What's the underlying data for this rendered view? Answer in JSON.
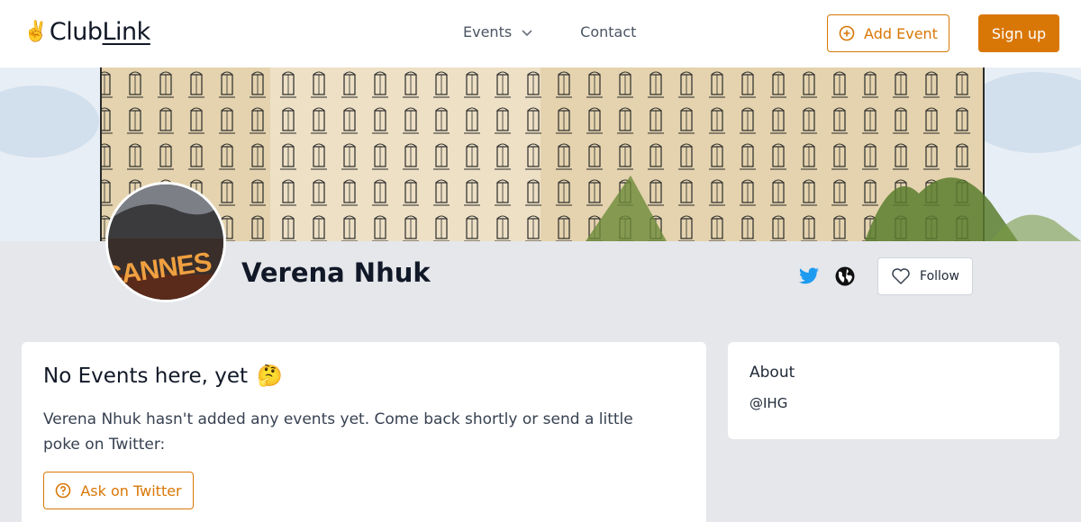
{
  "header": {
    "logo_icon": "victory-hand-emoji",
    "logo_prefix": "Club",
    "logo_suffix": "Link",
    "nav_events": "Events",
    "nav_contact": "Contact",
    "add_event_label": "Add Event",
    "signup_label": "Sign up"
  },
  "profile": {
    "name": "Verena Nhuk",
    "avatar_text": "CANNES",
    "follow_label": "Follow",
    "icons": [
      "twitter-icon",
      "globe-icon",
      "heart-icon"
    ]
  },
  "events_card": {
    "title": "No Events here, yet",
    "title_emoji": "🤔",
    "message": "Verena Nhuk hasn't added any events yet. Come back shortly or send a little poke on Twitter:",
    "ask_label": "Ask on Twitter"
  },
  "about_card": {
    "title": "About",
    "handle": "@IHG"
  },
  "colors": {
    "accent": "#d97706",
    "twitter": "#1d9bf0",
    "background": "#e5e7eb"
  }
}
